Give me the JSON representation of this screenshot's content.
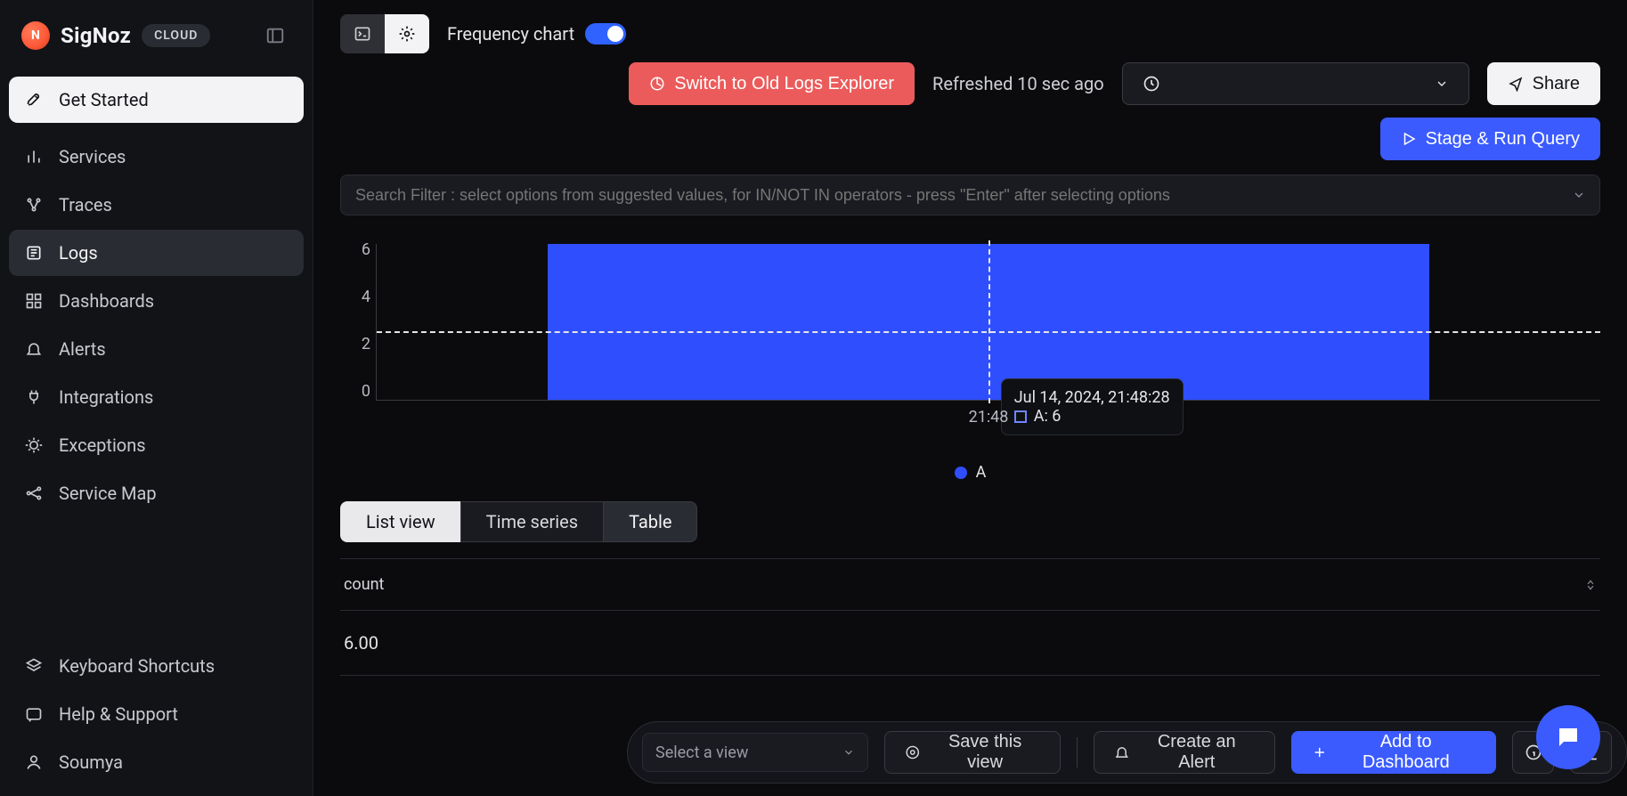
{
  "brand": {
    "name": "SigNoz",
    "tier": "CLOUD"
  },
  "sidebar": {
    "primary": "Get Started",
    "items": [
      "Services",
      "Traces",
      "Logs",
      "Dashboards",
      "Alerts",
      "Integrations",
      "Exceptions",
      "Service Map"
    ],
    "active_index": 2,
    "footer": [
      "Keyboard Shortcuts",
      "Help & Support",
      "Soumya"
    ]
  },
  "topbar": {
    "frequency_label": "Frequency chart",
    "frequency_on": true,
    "switch_old": "Switch to Old Logs Explorer",
    "refreshed": "Refreshed 10 sec ago",
    "time_range": "",
    "share": "Share",
    "run": "Stage & Run Query"
  },
  "search": {
    "placeholder": "Search Filter : select options from suggested values, for IN/NOT IN operators - press \"Enter\" after selecting options"
  },
  "chart": {
    "y_ticks": [
      "6",
      "4",
      "2",
      "0"
    ],
    "x_tick": "21:48",
    "legend": "A",
    "tooltip_date": "Jul 14, 2024, 21:48:28",
    "tooltip_value": "A: 6"
  },
  "chart_data": {
    "type": "bar",
    "series": [
      {
        "name": "A",
        "categories": [
          "21:48:28"
        ],
        "values": [
          6
        ]
      }
    ],
    "x_tick_labels": [
      "21:48"
    ],
    "ylim": [
      0,
      6
    ],
    "y_ticks": [
      0,
      2,
      4,
      6
    ],
    "tooltip": {
      "timestamp": "Jul 14, 2024, 21:48:28",
      "series": "A",
      "value": 6
    }
  },
  "tabs": {
    "items": [
      "List view",
      "Time series",
      "Table"
    ],
    "active_index": 2
  },
  "table": {
    "header": "count",
    "rows": [
      "6.00"
    ]
  },
  "actions": {
    "select_view_placeholder": "Select a view",
    "save_view": "Save this view",
    "create_alert": "Create an Alert",
    "add_dashboard": "Add to Dashboard"
  },
  "colors": {
    "accent": "#3b5bff",
    "danger": "#ec5b5b",
    "bar": "#2f4fff"
  }
}
